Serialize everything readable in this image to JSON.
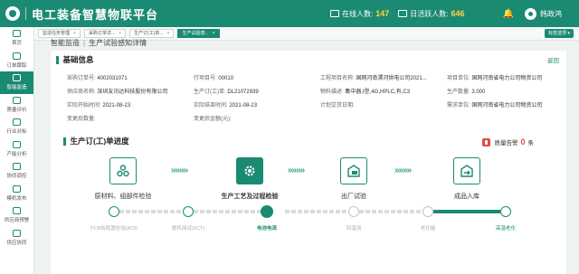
{
  "header": {
    "title": "电工装备智慧物联平台",
    "online_label": "在线人数:",
    "online_count": "147",
    "daily_label": "日活跃人数:",
    "daily_count": "646",
    "username": "韩政鸿"
  },
  "sidebar": {
    "items": [
      {
        "label": "首页",
        "icon": "home-icon"
      },
      {
        "label": "订单跟踪",
        "icon": "order-icon"
      },
      {
        "label": "智能监造",
        "icon": "monitor-icon",
        "active": true
      },
      {
        "label": "质量评价",
        "icon": "quality-icon"
      },
      {
        "label": "行业对标",
        "icon": "benchmark-icon"
      },
      {
        "label": "产能分析",
        "icon": "capacity-icon"
      },
      {
        "label": "协同调控",
        "icon": "collab-icon"
      },
      {
        "label": "模机发布",
        "icon": "release-icon"
      },
      {
        "label": "供应商预警",
        "icon": "warning-icon"
      },
      {
        "label": "供应协同",
        "icon": "supply-icon"
      }
    ]
  },
  "tabs": [
    {
      "label": "监造任务管理"
    },
    {
      "label": "采购订单详..."
    },
    {
      "label": "生产订(工)单..."
    },
    {
      "label": "生产试验感...",
      "active": true
    }
  ],
  "tabs_action": "标签选项 ▾",
  "breadcrumb": {
    "parent": "智能监造",
    "current": "生产试验感知详情"
  },
  "basic": {
    "title": "基础信息",
    "back": "返回",
    "fields": {
      "po_label": "采购订单号:",
      "po_value": "4002031071",
      "line_label": "行项目号:",
      "line_value": "00010",
      "proj_label": "工程项目名称:",
      "proj_value": "国网河南漯河供电公司2021...",
      "unit_label": "项目单位:",
      "unit_value": "国网河南省电力公司物资公司",
      "supplier_label": "供应商名称:",
      "supplier_value": "深圳友讯达科技股份有限公司",
      "prod_label": "生产订(工)单:",
      "prod_value": "DL21072939",
      "mat_label": "物料描述:",
      "mat_value": "集中器,I型,4G,HPLC,有,C3",
      "qty_label": "生产数量:",
      "qty_value": "3.000",
      "start_label": "实际开始时间:",
      "start_value": "2021-08-23",
      "end_label": "实际结束时间:",
      "end_value": "2021-08-23",
      "plan_label": "计划交货日期:",
      "plan_value": "",
      "demand_label": "需求单位:",
      "demand_value": "国网河南省电力公司物资公司",
      "chg_qty_label": "变更后数量:",
      "chg_qty_value": "",
      "chg_amt_label": "变更后金额(元):",
      "chg_amt_value": ""
    }
  },
  "progress": {
    "title": "生产订(工)单进度",
    "alarm_label": "质量告警",
    "alarm_count": "0",
    "alarm_unit": "条",
    "stages": [
      {
        "name": "原材料、组部件检验",
        "icon": "materials-icon"
      },
      {
        "name": "生产工艺及过程检验",
        "icon": "gear-icon",
        "current": true
      },
      {
        "name": "出厂试验",
        "icon": "factory-icon"
      },
      {
        "name": "成品入库",
        "icon": "warehouse-icon"
      }
    ],
    "chevrons": "»»»»",
    "nodes": [
      {
        "label": "PCB板配置检验(AOI)"
      },
      {
        "label": "整机测试(FCT)"
      },
      {
        "label": "电池电流",
        "current": true
      },
      {
        "label": "回温测"
      },
      {
        "label": "老化箱"
      },
      {
        "label": "高温老化",
        "last": true
      }
    ]
  }
}
